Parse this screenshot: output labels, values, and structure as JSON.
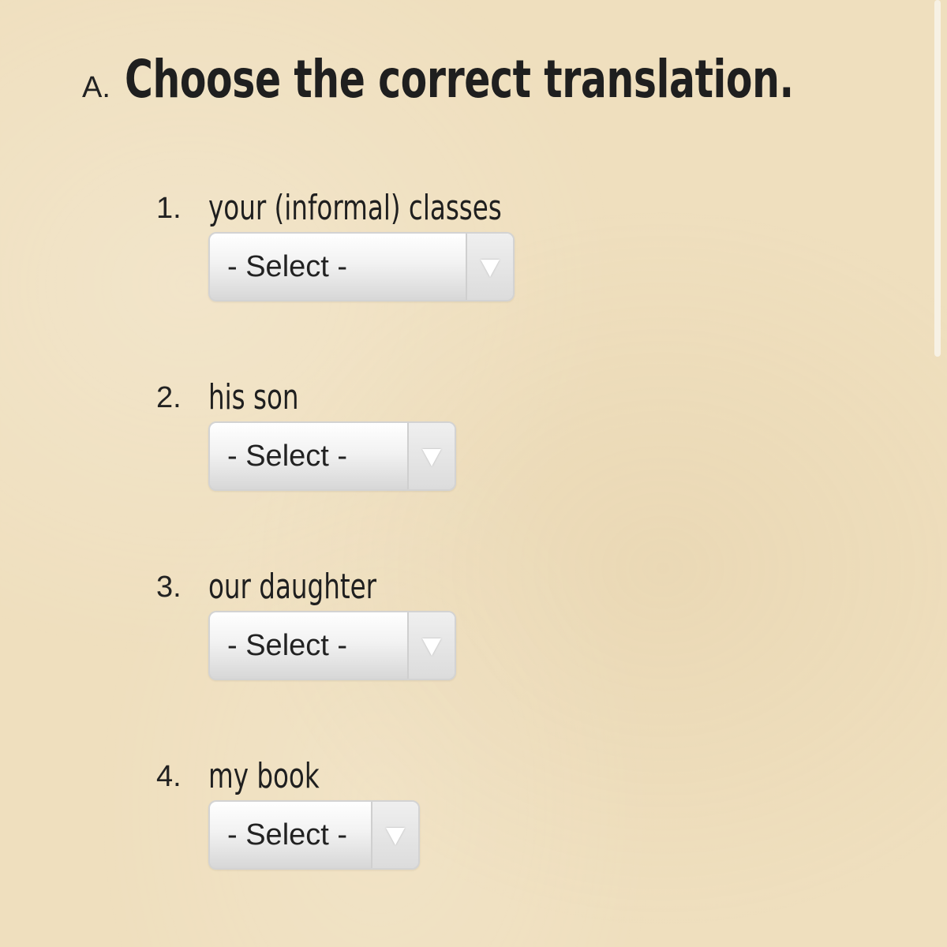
{
  "heading": {
    "marker": "A.",
    "title": "Choose the correct translation."
  },
  "select_placeholder": "- Select -",
  "items": [
    {
      "number": "1.",
      "prompt": "your (informal) classes",
      "selected": "- Select -"
    },
    {
      "number": "2.",
      "prompt": "his son",
      "selected": "- Select -"
    },
    {
      "number": "3.",
      "prompt": "our daughter",
      "selected": "- Select -"
    },
    {
      "number": "4.",
      "prompt": "my book",
      "selected": "- Select -"
    }
  ],
  "icons": {
    "dropdown": "chevron-down-icon"
  }
}
